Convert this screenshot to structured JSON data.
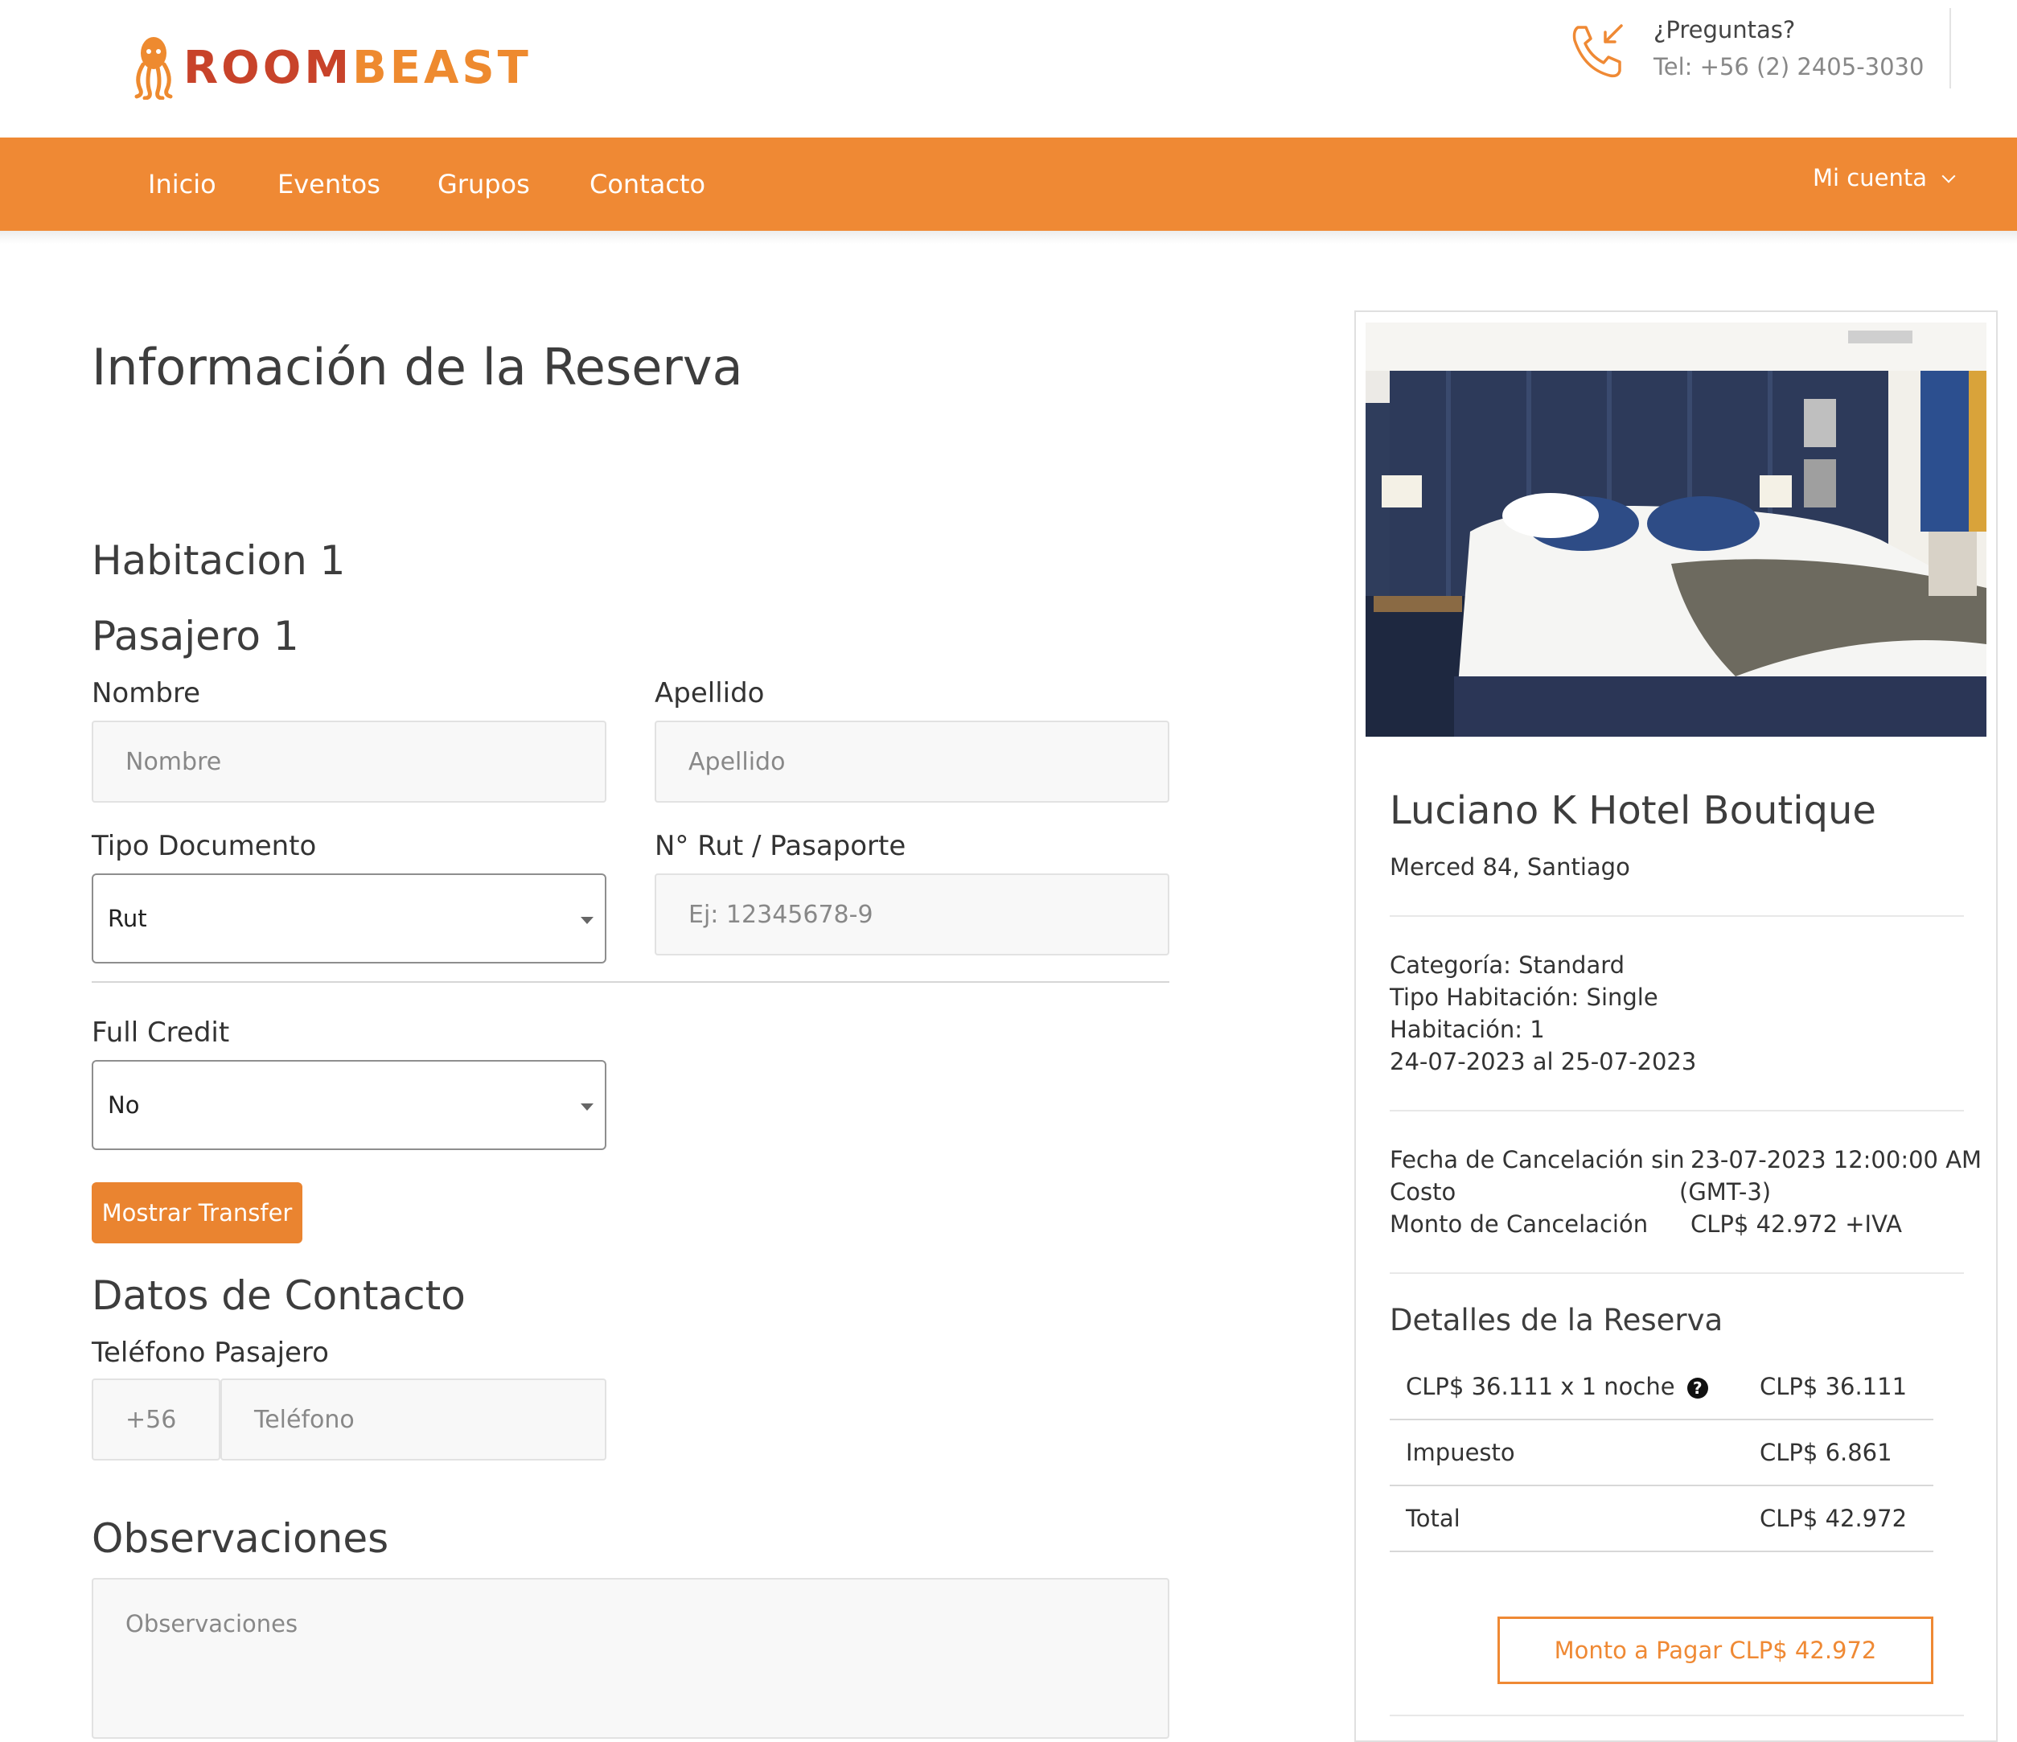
{
  "header": {
    "brand_part1": "ROOM",
    "brand_part2": "BEAST",
    "questions": "¿Preguntas?",
    "phone": "Tel: +56 (2) 2405-3030"
  },
  "nav": {
    "items": [
      "Inicio",
      "Eventos",
      "Grupos",
      "Contacto"
    ],
    "account": "Mi cuenta"
  },
  "form": {
    "title": "Información de la Reserva",
    "room_heading": "Habitacion 1",
    "passenger_heading": "Pasajero 1",
    "nombre_label": "Nombre",
    "nombre_placeholder": "Nombre",
    "apellido_label": "Apellido",
    "apellido_placeholder": "Apellido",
    "tipo_doc_label": "Tipo Documento",
    "tipo_doc_value": "Rut",
    "rut_label": "N° Rut / Pasaporte",
    "rut_placeholder": "Ej: 12345678-9",
    "full_credit_label": "Full Credit",
    "full_credit_value": "No",
    "transfer_button": "Mostrar Transfer",
    "contact_heading": "Datos de Contacto",
    "phone_label": "Teléfono Pasajero",
    "phone_prefix": "+56",
    "phone_placeholder": "Teléfono",
    "observations_heading": "Observaciones",
    "observations_placeholder": "Observaciones"
  },
  "sidebar": {
    "hotel_name": "Luciano K Hotel Boutique",
    "address": "Merced 84, Santiago",
    "category": "Categoría: Standard",
    "room_type": "Tipo Habitación: Single",
    "room": "Habitación: 1",
    "dates": "24-07-2023 al 25-07-2023",
    "cancel_date_label_1": "Fecha de Cancelación sin",
    "cancel_date_label_2": "Costo",
    "cancel_date_value_1": "23-07-2023 12:00:00 AM",
    "cancel_date_value_2": "(GMT-3)",
    "cancel_amount_label": "Monto de Cancelación",
    "cancel_amount_value": "CLP$ 42.972 +IVA",
    "details_heading": "Detalles de la Reserva",
    "rows": [
      {
        "label": "CLP$ 36.111 x 1 noche",
        "value": "CLP$ 36.111"
      },
      {
        "label": "Impuesto",
        "value": "CLP$ 6.861"
      },
      {
        "label": "Total",
        "value": "CLP$ 42.972"
      }
    ],
    "pay_button": "Monto a Pagar CLP$ 42.972"
  },
  "colors": {
    "brand_orange": "#ef8934",
    "brand_red": "#c8432a"
  }
}
